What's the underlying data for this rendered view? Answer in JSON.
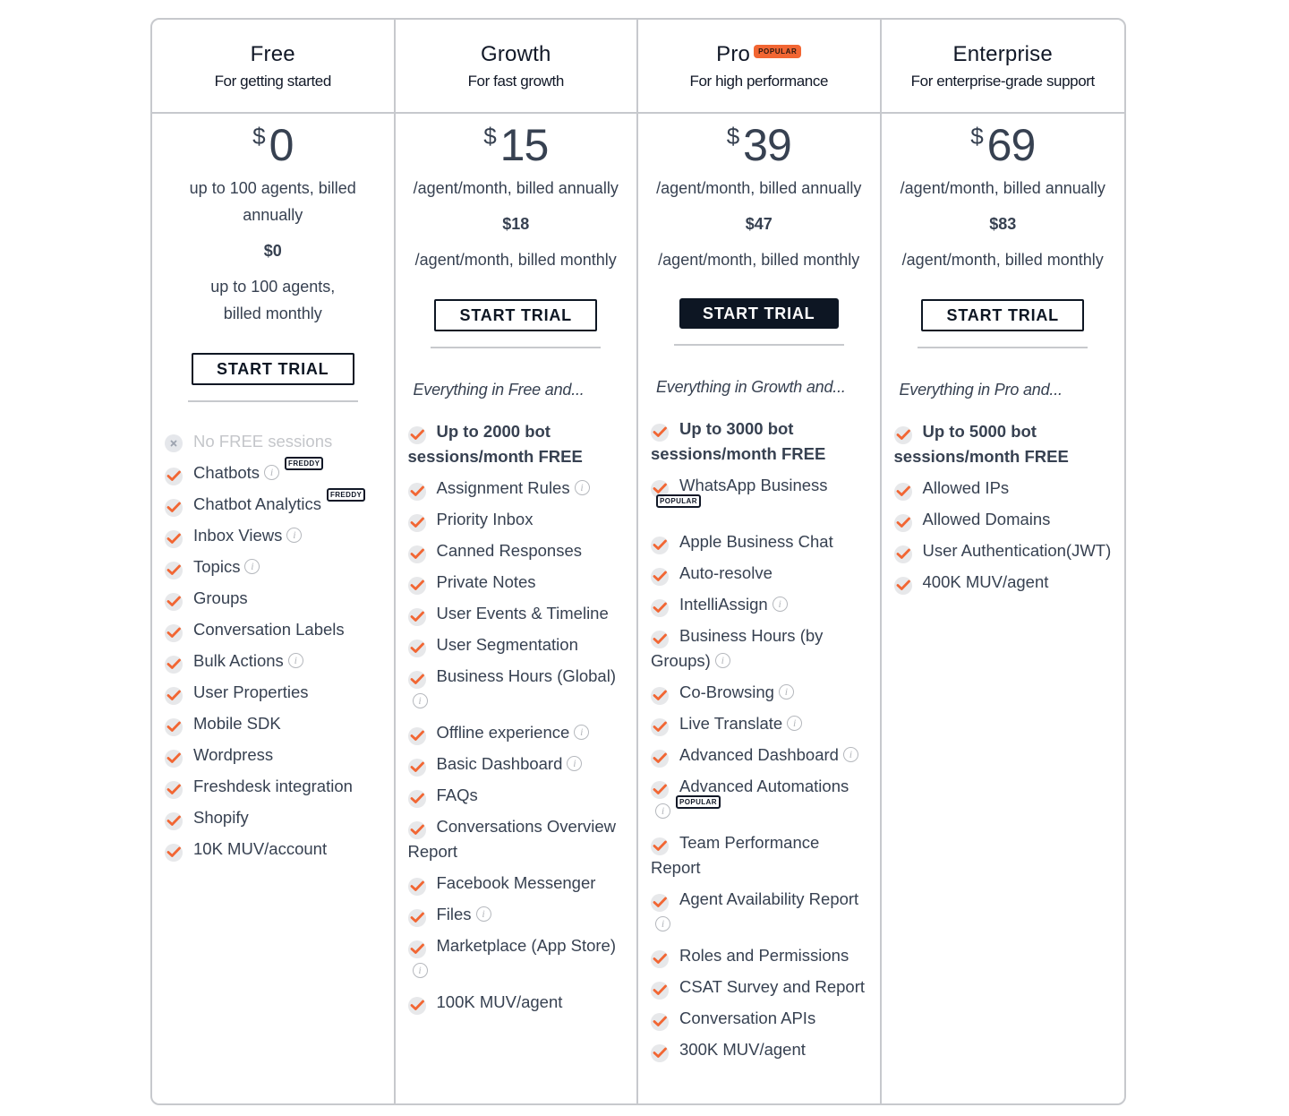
{
  "colors": {
    "accent": "#f26633",
    "dark": "#0d1623",
    "border": "#c7c9cd",
    "text": "#374151"
  },
  "plans": [
    {
      "name": "Free",
      "tagline": "For getting started",
      "currency": "$",
      "price": "0",
      "price_annual_note": "up to 100 agents, billed annually",
      "price_monthly": "$0",
      "price_monthly_note": "up to 100 agents, billed monthly",
      "cta": "START TRIAL",
      "intro": "",
      "features": [
        {
          "label": "No FREE sessions",
          "included": false
        },
        {
          "label": "Chatbots",
          "info": true,
          "badge": "FREDDY"
        },
        {
          "label": "Chatbot Analytics",
          "badge": "FREDDY"
        },
        {
          "label": "Inbox Views",
          "info": true
        },
        {
          "label": "Topics",
          "info": true
        },
        {
          "label": "Groups"
        },
        {
          "label": "Conversation Labels"
        },
        {
          "label": "Bulk Actions",
          "info": true
        },
        {
          "label": "User Properties"
        },
        {
          "label": "Mobile SDK"
        },
        {
          "label": "Wordpress"
        },
        {
          "label": "Freshdesk integration"
        },
        {
          "label": "Shopify"
        },
        {
          "label": "10K MUV/account"
        }
      ]
    },
    {
      "name": "Growth",
      "tagline": "For fast growth",
      "currency": "$",
      "price": "15",
      "price_annual_note": "/agent/month, billed annually",
      "price_monthly": "$18",
      "price_monthly_note": "/agent/month, billed monthly",
      "cta": "START TRIAL",
      "intro": "Everything in Free and...",
      "features": [
        {
          "label": "Up to 2000 bot sessions/month FREE",
          "bold": true
        },
        {
          "label": "Assignment Rules",
          "info": true
        },
        {
          "label": "Priority Inbox"
        },
        {
          "label": "Canned Responses"
        },
        {
          "label": "Private Notes"
        },
        {
          "label": "User Events & Timeline"
        },
        {
          "label": "User Segmentation"
        },
        {
          "label": "Business Hours (Global)",
          "info": true
        },
        {
          "label": "Offline experience",
          "info": true
        },
        {
          "label": "Basic Dashboard",
          "info": true
        },
        {
          "label": "FAQs"
        },
        {
          "label": "Conversations Overview Report"
        },
        {
          "label": "Facebook Messenger"
        },
        {
          "label": "Files",
          "info": true
        },
        {
          "label": "Marketplace (App Store)",
          "info": true
        },
        {
          "label": "100K MUV/agent"
        }
      ]
    },
    {
      "name": "Pro",
      "badge": "POPULAR",
      "tagline": "For high performance",
      "currency": "$",
      "price": "39",
      "price_annual_note": "/agent/month, billed annually",
      "price_monthly": "$47",
      "price_monthly_note": "/agent/month, billed monthly",
      "cta": "START TRIAL",
      "intro": "Everything in Growth and...",
      "features": [
        {
          "label": "Up to 3000 bot sessions/month FREE",
          "bold": true
        },
        {
          "label": "WhatsApp Business",
          "badge": "POPULAR"
        },
        {
          "label": "Apple Business Chat"
        },
        {
          "label": "Auto-resolve"
        },
        {
          "label": "IntelliAssign",
          "info": true
        },
        {
          "label": "Business Hours (by Groups)",
          "info": true
        },
        {
          "label": "Co-Browsing",
          "info": true
        },
        {
          "label": "Live Translate",
          "info": true
        },
        {
          "label": "Advanced Dashboard",
          "info": true
        },
        {
          "label": "Advanced Automations",
          "info": true,
          "badge": "POPULAR"
        },
        {
          "label": "Team Performance Report"
        },
        {
          "label": "Agent Availability Report",
          "info": true
        },
        {
          "label": "Roles and Permissions"
        },
        {
          "label": "CSAT Survey and Report"
        },
        {
          "label": "Conversation APIs"
        },
        {
          "label": "300K MUV/agent"
        }
      ]
    },
    {
      "name": "Enterprise",
      "tagline": "For enterprise-grade support",
      "currency": "$",
      "price": "69",
      "price_annual_note": "/agent/month, billed annually",
      "price_monthly": "$83",
      "price_monthly_note": "/agent/month, billed monthly",
      "cta": "START TRIAL",
      "intro": "Everything in Pro and...",
      "features": [
        {
          "label": "Up to 5000 bot sessions/month FREE",
          "bold": true
        },
        {
          "label": "Allowed IPs"
        },
        {
          "label": "Allowed Domains"
        },
        {
          "label": "User Authentication(JWT)"
        },
        {
          "label": "400K MUV/agent"
        }
      ]
    }
  ]
}
